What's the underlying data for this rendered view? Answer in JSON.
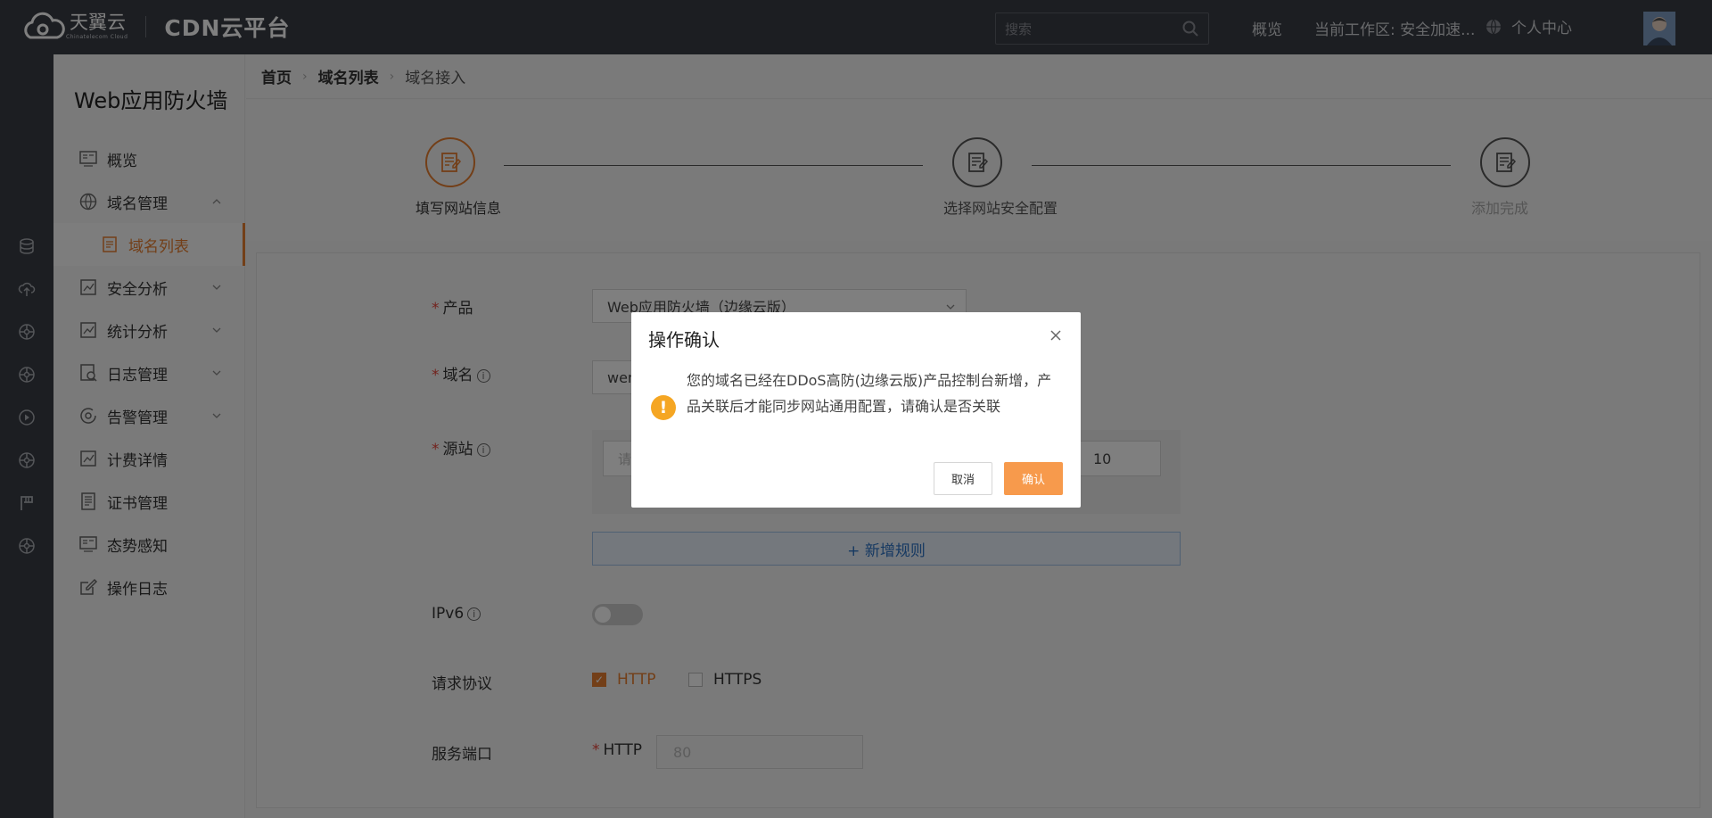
{
  "header": {
    "brand": "天翼云",
    "brand_sub": "Chinatelecom Cloud",
    "platform": "CDN云平台",
    "search_placeholder": "搜索",
    "nav_overview": "概览",
    "nav_workspace": "当前工作区: 安全加速...",
    "nav_personal": "个人中心"
  },
  "rail_icons": [
    "database-icon",
    "cloud-upload-icon",
    "network-icon",
    "network-icon",
    "play-icon",
    "network-icon",
    "flag-icon",
    "network-icon"
  ],
  "sidebar": {
    "title": "Web应用防火墙",
    "items": [
      {
        "label": "概览",
        "icon": "monitor-icon"
      },
      {
        "label": "域名管理",
        "icon": "globe-icon",
        "expanded": true
      },
      {
        "label": "域名列表",
        "icon": "list-icon",
        "active": true
      },
      {
        "label": "安全分析",
        "icon": "chart-icon"
      },
      {
        "label": "统计分析",
        "icon": "chart-icon"
      },
      {
        "label": "日志管理",
        "icon": "log-icon"
      },
      {
        "label": "告警管理",
        "icon": "alert-icon"
      },
      {
        "label": "计费详情",
        "icon": "chart-icon"
      },
      {
        "label": "证书管理",
        "icon": "certificate-icon"
      },
      {
        "label": "态势感知",
        "icon": "monitor-icon"
      },
      {
        "label": "操作日志",
        "icon": "edit-icon"
      }
    ]
  },
  "breadcrumb": [
    "首页",
    "域名列表",
    "域名接入"
  ],
  "steps": [
    {
      "label": "填写网站信息",
      "active": true
    },
    {
      "label": "选择网站安全配置",
      "active": false
    },
    {
      "label": "添加完成",
      "active": false
    }
  ],
  "form": {
    "product_label": "产品",
    "product_value": "Web应用防火墙（边缘云版）",
    "domain_label": "域名",
    "domain_value": "wen",
    "origin_label": "源站",
    "origin_placeholder": "请",
    "origin_weight": "10",
    "add_rule": "+ 新增规则",
    "ipv6_label": "IPv6",
    "ipv6_on": false,
    "protocol_label": "请求协议",
    "protocol_http": "HTTP",
    "protocol_https": "HTTPS",
    "port_label": "服务端口",
    "port_http_label": "HTTP",
    "port_http_placeholder": "80"
  },
  "dialog": {
    "title": "操作确认",
    "message": "您的域名已经在DDoS高防(边缘云版)产品控制台新增，产品关联后才能同步网站通用配置，请确认是否关联",
    "cancel": "取消",
    "confirm": "确认"
  }
}
